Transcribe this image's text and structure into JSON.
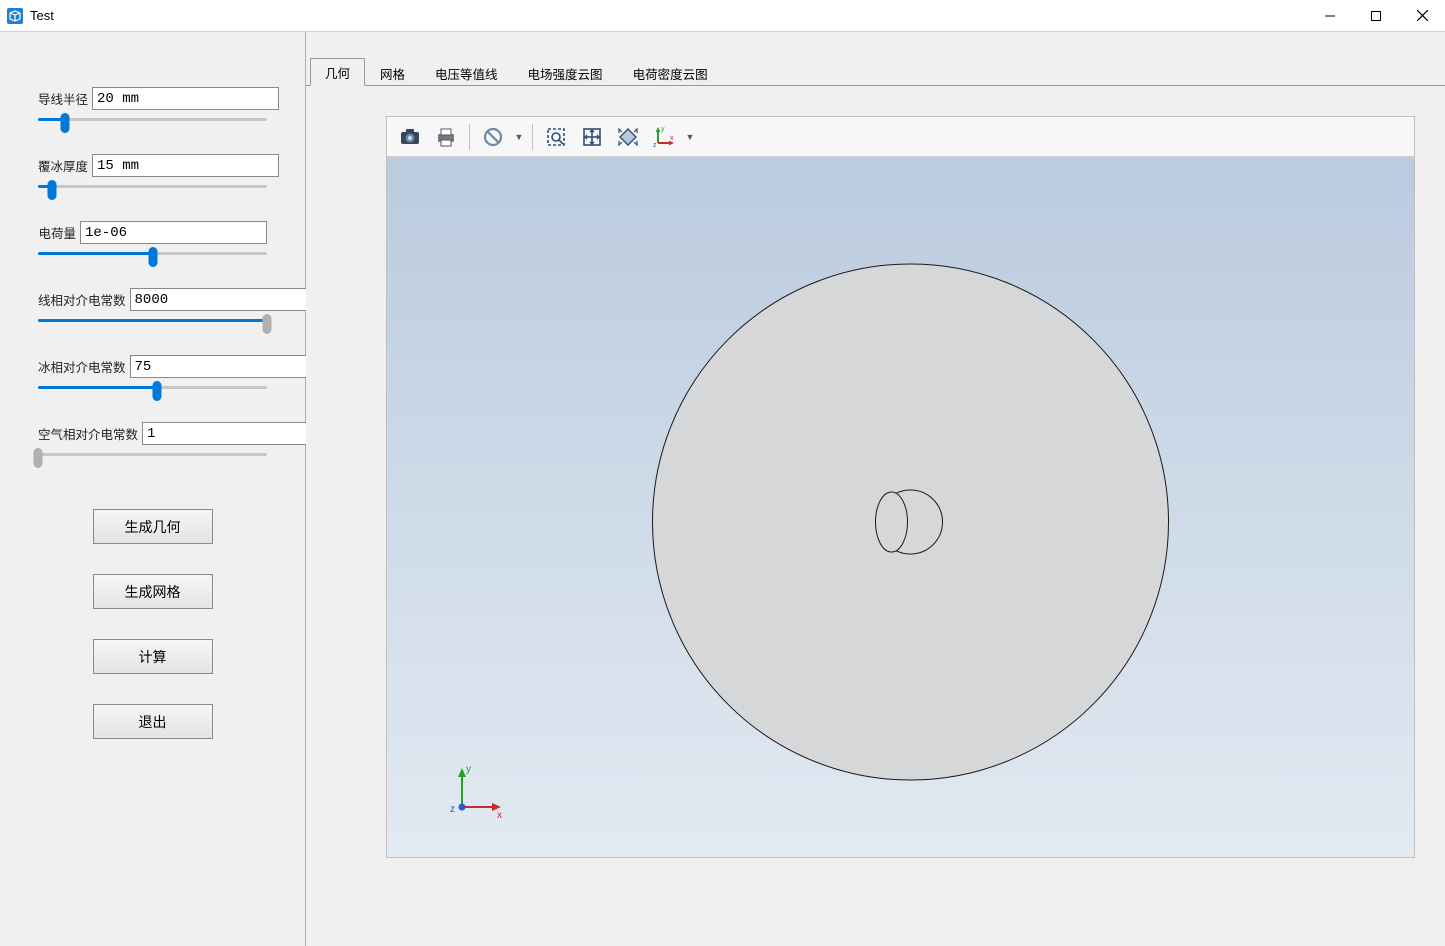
{
  "window": {
    "title": "Test"
  },
  "params": {
    "wire_radius": {
      "label": "导线半径",
      "value": "20 mm",
      "pos": 12
    },
    "ice_thickness": {
      "label": "覆冰厚度",
      "value": "15 mm",
      "pos": 6
    },
    "charge": {
      "label": "电荷量",
      "value": "1e-06",
      "pos": 50
    },
    "eps_wire": {
      "label": "线相对介电常数",
      "value": "8000",
      "pos": 100
    },
    "eps_ice": {
      "label": "冰相对介电常数",
      "value": "75",
      "pos": 52
    },
    "eps_air": {
      "label": "空气相对介电常数",
      "value": "1",
      "pos": 0
    }
  },
  "buttons": {
    "gen_geometry": "生成几何",
    "gen_mesh": "生成网格",
    "compute": "计算",
    "exit": "退出"
  },
  "tabs": {
    "geometry": "几何",
    "mesh": "网格",
    "voltage": "电压等值线",
    "efield": "电场强度云图",
    "charge_cloud": "电荷密度云图"
  },
  "toolbar_icons": {
    "camera": "camera-icon",
    "print": "print-icon",
    "nosymbol": "nosymbol-icon",
    "zoombox": "zoom-box-icon",
    "fit": "fit-view-icon",
    "diamond": "diamond-icon",
    "axes": "axes-icon"
  },
  "axis_labels": {
    "x": "x",
    "y": "y",
    "z": "z"
  }
}
